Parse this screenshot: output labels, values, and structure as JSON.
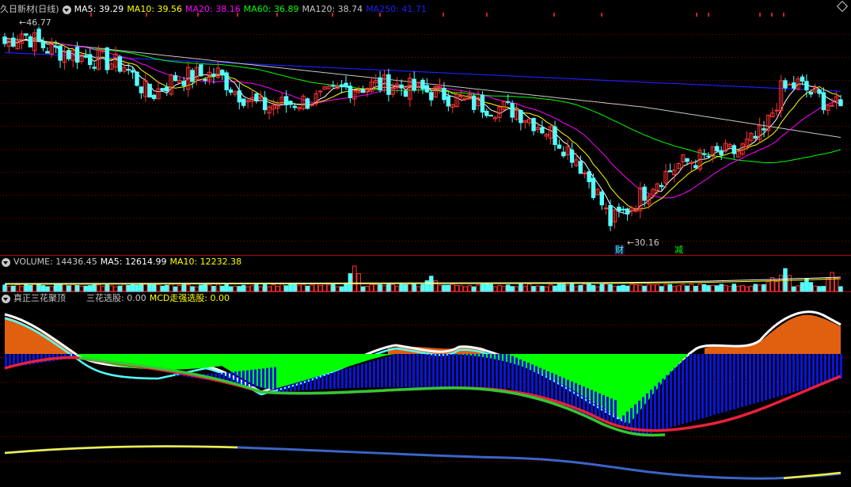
{
  "header_main": {
    "title": "久日新材(日线)",
    "ma": [
      {
        "label": "MA5: 39.29",
        "color": "#ffffff"
      },
      {
        "label": "MA10: 39.56",
        "color": "#ffff00"
      },
      {
        "label": "MA20: 38.16",
        "color": "#ff00ff"
      },
      {
        "label": "MA60: 36.89",
        "color": "#00ff00"
      },
      {
        "label": "MA120: 38.74",
        "color": "#c8c8c8"
      },
      {
        "label": "MA250: 41.71",
        "color": "#1e1eff"
      }
    ]
  },
  "header_volume": {
    "title": "VOLUME: 14436.45",
    "ma5": "MA5: 12614.99",
    "ma10": "MA10: 12232.38"
  },
  "header_indicator": {
    "title": "真正三花聚顶",
    "sanhua": "三花选股: 0.00",
    "mcd": "MCD走强选股: 0.00"
  },
  "annotations": {
    "high": "46.77",
    "low": "30.16",
    "tag_cai": "财",
    "tag_jian": "减"
  },
  "colors": {
    "up": "#ff3232",
    "down": "#54ffff",
    "ma5": "#ffffff",
    "ma10": "#ffff00",
    "ma20": "#ff00ff",
    "ma60": "#00ff00",
    "ma120": "#c8c8c8",
    "ma250": "#1e1eff",
    "grid": "#8b0000",
    "orange": "#e06010",
    "cyan": "#54ffff",
    "green": "#00ff00",
    "blue": "#0a14d8",
    "red": "#e8203a",
    "yellow": "#f0f040",
    "steelblue": "#3c64c8"
  },
  "chart_data": {
    "type": "candlestick",
    "ylim": [
      30.16,
      46.77
    ],
    "price_keys": [
      [
        0,
        44.8
      ],
      [
        4,
        45.6
      ],
      [
        10,
        44.4
      ],
      [
        20,
        43.7
      ],
      [
        28,
        43.1
      ],
      [
        34,
        40.8
      ],
      [
        40,
        42.2
      ],
      [
        50,
        42.5
      ],
      [
        54,
        41.2
      ],
      [
        60,
        40.0
      ],
      [
        66,
        40.2
      ],
      [
        74,
        40.6
      ],
      [
        80,
        41.4
      ],
      [
        90,
        41.7
      ],
      [
        96,
        41.3
      ],
      [
        102,
        41.0
      ],
      [
        110,
        40.2
      ],
      [
        120,
        39.7
      ],
      [
        128,
        38.0
      ],
      [
        134,
        36.1
      ],
      [
        139,
        33.3
      ],
      [
        142,
        31.2
      ],
      [
        146,
        32.2
      ],
      [
        152,
        34.2
      ],
      [
        158,
        35.6
      ],
      [
        166,
        36.3
      ],
      [
        172,
        36.6
      ],
      [
        178,
        38.0
      ],
      [
        182,
        41.2
      ],
      [
        186,
        41.7
      ],
      [
        190,
        40.8
      ],
      [
        196,
        39.8
      ]
    ],
    "candle_count": 197,
    "volume_peaks": [
      [
        82,
        1.0
      ],
      [
        100,
        0.6
      ],
      [
        180,
        0.55
      ],
      [
        183,
        0.9
      ],
      [
        188,
        0.5
      ],
      [
        194,
        0.75
      ]
    ],
    "volume_latest": 14436.45,
    "volume_ma5": 12614.99,
    "volume_ma10": 12232.38
  }
}
